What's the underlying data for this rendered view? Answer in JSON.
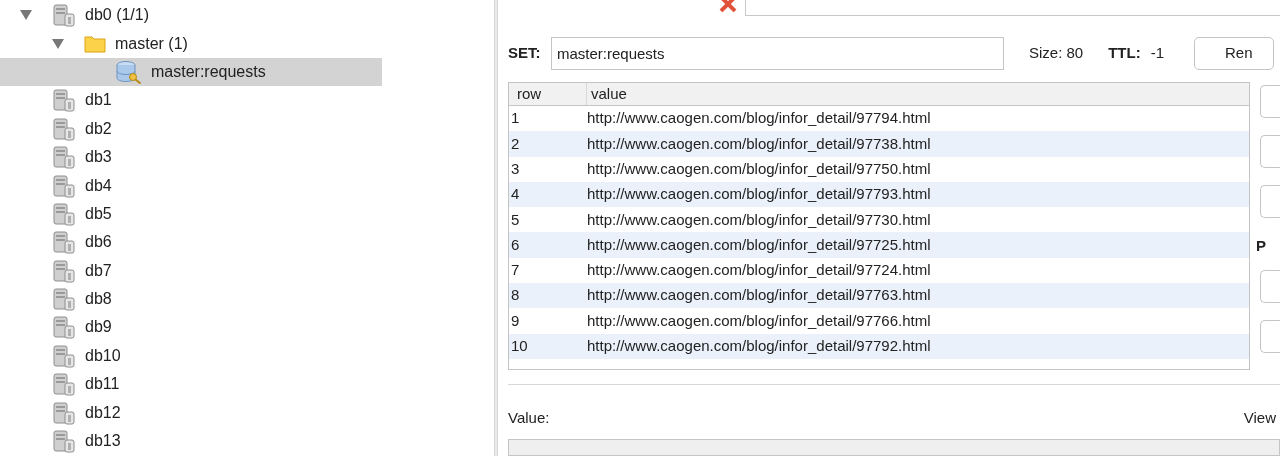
{
  "tree": [
    {
      "kind": "database",
      "label": "db0 (1/1)",
      "expanded": true,
      "selected": false,
      "children": [
        {
          "kind": "folder",
          "label": "master (1)",
          "expanded": true,
          "selected": false,
          "children": [
            {
              "kind": "key",
              "label": "master:requests",
              "selected": true
            }
          ]
        }
      ]
    },
    {
      "kind": "database",
      "label": "db1",
      "selected": false
    },
    {
      "kind": "database",
      "label": "db2",
      "selected": false
    },
    {
      "kind": "database",
      "label": "db3",
      "selected": false
    },
    {
      "kind": "database",
      "label": "db4",
      "selected": false
    },
    {
      "kind": "database",
      "label": "db5",
      "selected": false
    },
    {
      "kind": "database",
      "label": "db6",
      "selected": false
    },
    {
      "kind": "database",
      "label": "db7",
      "selected": false
    },
    {
      "kind": "database",
      "label": "db8",
      "selected": false
    },
    {
      "kind": "database",
      "label": "db9",
      "selected": false
    },
    {
      "kind": "database",
      "label": "db10",
      "selected": false
    },
    {
      "kind": "database",
      "label": "db11",
      "selected": false
    },
    {
      "kind": "database",
      "label": "db12",
      "selected": false
    },
    {
      "kind": "database",
      "label": "db13",
      "selected": false
    }
  ],
  "editor": {
    "key_type_label": "SET:",
    "key_name": "master:requests",
    "size": "Size: 80",
    "ttl_label": "TTL:",
    "ttl_value": "-1",
    "top_button": "Ren",
    "side_label": "P",
    "table": {
      "columns": [
        "row",
        "value"
      ],
      "rows": [
        [
          "1",
          "http://www.caogen.com/blog/infor_detail/97794.html"
        ],
        [
          "2",
          "http://www.caogen.com/blog/infor_detail/97738.html"
        ],
        [
          "3",
          "http://www.caogen.com/blog/infor_detail/97750.html"
        ],
        [
          "4",
          "http://www.caogen.com/blog/infor_detail/97793.html"
        ],
        [
          "5",
          "http://www.caogen.com/blog/infor_detail/97730.html"
        ],
        [
          "6",
          "http://www.caogen.com/blog/infor_detail/97725.html"
        ],
        [
          "7",
          "http://www.caogen.com/blog/infor_detail/97724.html"
        ],
        [
          "8",
          "http://www.caogen.com/blog/infor_detail/97763.html"
        ],
        [
          "9",
          "http://www.caogen.com/blog/infor_detail/97766.html"
        ],
        [
          "10",
          "http://www.caogen.com/blog/infor_detail/97792.html"
        ]
      ]
    },
    "value_label": "Value:",
    "view_label": "View"
  }
}
